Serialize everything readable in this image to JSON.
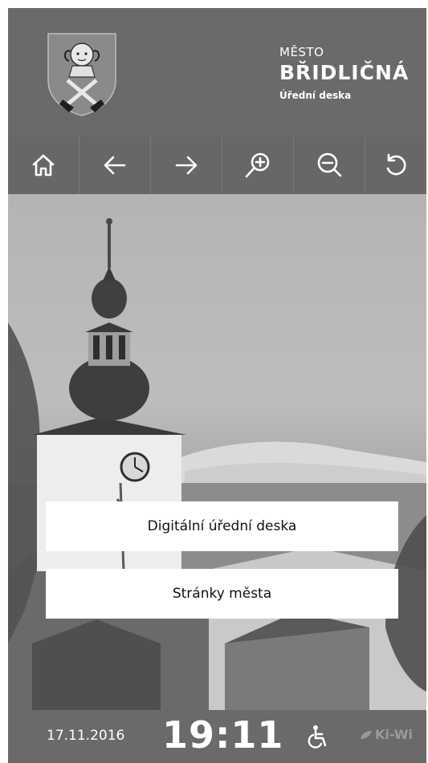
{
  "header": {
    "title_small": "MĚSTO",
    "title_big": "BŘIDLIČNÁ",
    "subtitle": "Úřední deska"
  },
  "toolbar": {
    "buttons": [
      {
        "icon": "home-icon"
      },
      {
        "icon": "arrow-left-icon"
      },
      {
        "icon": "arrow-right-icon"
      },
      {
        "icon": "zoom-in-icon"
      },
      {
        "icon": "zoom-out-icon"
      },
      {
        "icon": "refresh-icon"
      }
    ]
  },
  "main": {
    "buttons": [
      {
        "label": "Digitální úřední deska"
      },
      {
        "label": "Stránky města"
      }
    ]
  },
  "footer": {
    "date": "17.11.2016",
    "time": "19:11",
    "brand": "Ki-Wi"
  },
  "colors": {
    "bar": "#6a6a6a",
    "button_bg": "#ffffff",
    "text_light": "#ffffff"
  }
}
